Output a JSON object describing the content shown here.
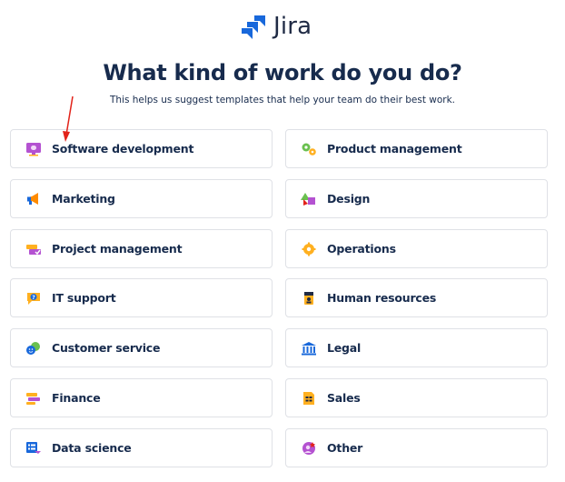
{
  "logo": {
    "text": "Jira",
    "icon": "jira-logo-icon",
    "color": "#1868DB"
  },
  "header": {
    "title": "What kind of work do you do?",
    "subtitle": "This helps us suggest templates that help your team do their best work."
  },
  "options": {
    "left": [
      {
        "label": "Software development",
        "icon": "monitor-icon"
      },
      {
        "label": "Marketing",
        "icon": "megaphone-icon"
      },
      {
        "label": "Project management",
        "icon": "task-cards-icon"
      },
      {
        "label": "IT support",
        "icon": "help-chat-icon"
      },
      {
        "label": "Customer service",
        "icon": "customer-faces-icon"
      },
      {
        "label": "Finance",
        "icon": "stacked-bars-icon"
      },
      {
        "label": "Data science",
        "icon": "data-list-icon"
      }
    ],
    "right": [
      {
        "label": "Product management",
        "icon": "gears-icon"
      },
      {
        "label": "Design",
        "icon": "shapes-icon"
      },
      {
        "label": "Operations",
        "icon": "gear-icon"
      },
      {
        "label": "Human resources",
        "icon": "id-badge-icon"
      },
      {
        "label": "Legal",
        "icon": "courthouse-icon"
      },
      {
        "label": "Sales",
        "icon": "spreadsheet-icon"
      },
      {
        "label": "Other",
        "icon": "person-star-icon"
      }
    ]
  },
  "colors": {
    "text": "#172B4D",
    "border": "#DFE1E6",
    "annotation_arrow": "#E2231A"
  }
}
